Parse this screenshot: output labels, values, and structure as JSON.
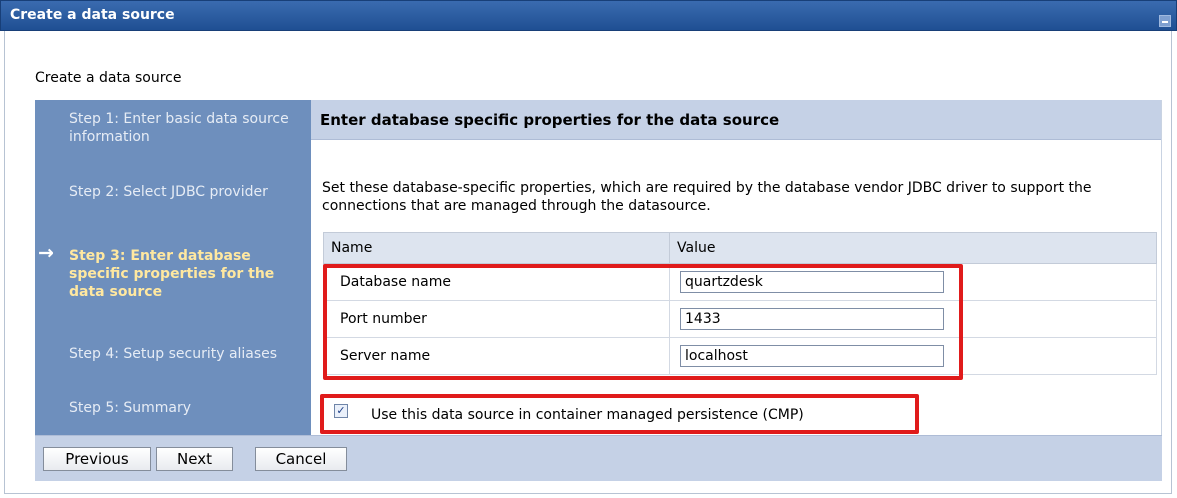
{
  "window": {
    "title": "Create a data source"
  },
  "page": {
    "heading": "Create a data source"
  },
  "wizard": {
    "steps": [
      {
        "label": "Step 1: Enter basic data source information",
        "active": false
      },
      {
        "label": "Step 2: Select JDBC provider",
        "active": false
      },
      {
        "label": "Step 3: Enter database specific properties for the data source",
        "active": true
      },
      {
        "label": "Step 4: Setup security aliases",
        "active": false
      },
      {
        "label": "Step 5: Summary",
        "active": false
      }
    ]
  },
  "content": {
    "header": "Enter database specific properties for the data source",
    "description": "Set these database-specific properties, which are required by the database vendor JDBC driver to support the connections that are managed through the datasource.",
    "table": {
      "columns": [
        "Name",
        "Value"
      ],
      "rows": [
        {
          "name": "Database name",
          "value": "quartzdesk"
        },
        {
          "name": "Port number",
          "value": "1433"
        },
        {
          "name": "Server name",
          "value": "localhost"
        }
      ]
    },
    "cmp_checkbox": {
      "label": "Use this data source in container managed persistence (CMP)",
      "checked": true
    }
  },
  "buttons": {
    "previous": "Previous",
    "next": "Next",
    "cancel": "Cancel"
  },
  "colors": {
    "highlight": "#e01b1b",
    "title_bar": "#2a5ba2",
    "steps_panel": "#6e8fbd",
    "active_step": "#ffe8a0"
  }
}
